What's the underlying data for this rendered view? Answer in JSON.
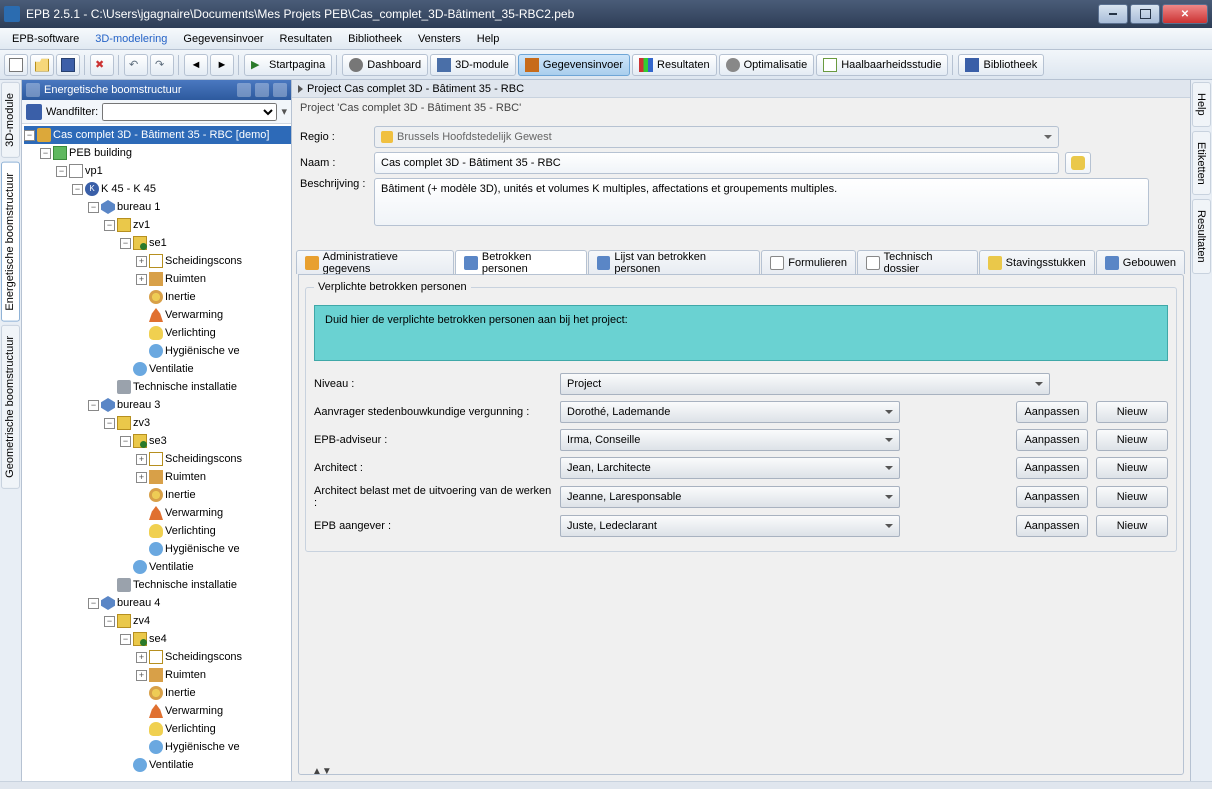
{
  "window": {
    "title": "EPB 2.5.1 - C:\\Users\\jgagnaire\\Documents\\Mes Projets PEB\\Cas_complet_3D-Bâtiment_35-RBC2.peb"
  },
  "menubar": [
    "EPB-software",
    "3D-modelering",
    "Gegevensinvoer",
    "Resultaten",
    "Bibliotheek",
    "Vensters",
    "Help"
  ],
  "toolbar": {
    "start": "Startpagina",
    "dashboard": "Dashboard",
    "module3d": "3D-module",
    "gegevens": "Gegevensinvoer",
    "resultaten": "Resultaten",
    "optimalisatie": "Optimalisatie",
    "haalbaar": "Haalbaarheidsstudie",
    "bibliotheek": "Bibliotheek"
  },
  "leftVTabs": [
    "3D-module",
    "Energetische boomstructuur",
    "Geometrische boomstructuur"
  ],
  "rightVTabs": [
    "Help",
    "Etiketten",
    "Resultaten"
  ],
  "treePanel": {
    "title": "Energetische boomstructuur",
    "filterLabel": "Wandfilter:"
  },
  "tree": [
    {
      "t": "Cas complet 3D - Bâtiment 35 - RBC [demo]",
      "i": "lock",
      "sel": true,
      "c": [
        {
          "t": "PEB building",
          "i": "peb",
          "c": [
            {
              "t": "vp1",
              "i": "vp",
              "c": [
                {
                  "t": "K 45 - K 45",
                  "i": "k",
                  "c": [
                    {
                      "t": "bureau 1",
                      "i": "bureau",
                      "c": [
                        {
                          "t": "zv1",
                          "i": "zv",
                          "c": [
                            {
                              "t": "se1",
                              "i": "se",
                              "c": [
                                {
                                  "t": "Scheidingscons",
                                  "i": "sc",
                                  "exp": "+"
                                },
                                {
                                  "t": "Ruimten",
                                  "i": "ruimten",
                                  "exp": "+"
                                },
                                {
                                  "t": "Inertie",
                                  "i": "inertie"
                                },
                                {
                                  "t": "Verwarming",
                                  "i": "verwarming"
                                },
                                {
                                  "t": "Verlichting",
                                  "i": "verlichting"
                                },
                                {
                                  "t": "Hygiënische ve",
                                  "i": "hyg"
                                }
                              ]
                            },
                            {
                              "t": "Ventilatie",
                              "i": "vent"
                            }
                          ]
                        },
                        {
                          "t": "Technische installatie",
                          "i": "tech"
                        }
                      ]
                    },
                    {
                      "t": "bureau 3",
                      "i": "bureau",
                      "c": [
                        {
                          "t": "zv3",
                          "i": "zv",
                          "c": [
                            {
                              "t": "se3",
                              "i": "se",
                              "c": [
                                {
                                  "t": "Scheidingscons",
                                  "i": "sc",
                                  "exp": "+"
                                },
                                {
                                  "t": "Ruimten",
                                  "i": "ruimten",
                                  "exp": "+"
                                },
                                {
                                  "t": "Inertie",
                                  "i": "inertie"
                                },
                                {
                                  "t": "Verwarming",
                                  "i": "verwarming"
                                },
                                {
                                  "t": "Verlichting",
                                  "i": "verlichting"
                                },
                                {
                                  "t": "Hygiënische ve",
                                  "i": "hyg"
                                }
                              ]
                            },
                            {
                              "t": "Ventilatie",
                              "i": "vent"
                            }
                          ]
                        },
                        {
                          "t": "Technische installatie",
                          "i": "tech"
                        }
                      ]
                    },
                    {
                      "t": "bureau 4",
                      "i": "bureau",
                      "c": [
                        {
                          "t": "zv4",
                          "i": "zv",
                          "c": [
                            {
                              "t": "se4",
                              "i": "se",
                              "c": [
                                {
                                  "t": "Scheidingscons",
                                  "i": "sc",
                                  "exp": "+"
                                },
                                {
                                  "t": "Ruimten",
                                  "i": "ruimten",
                                  "exp": "+"
                                },
                                {
                                  "t": "Inertie",
                                  "i": "inertie"
                                },
                                {
                                  "t": "Verwarming",
                                  "i": "verwarming"
                                },
                                {
                                  "t": "Verlichting",
                                  "i": "verlichting"
                                },
                                {
                                  "t": "Hygiënische ve",
                                  "i": "hyg"
                                }
                              ]
                            },
                            {
                              "t": "Ventilatie",
                              "i": "vent"
                            }
                          ]
                        }
                      ]
                    }
                  ]
                }
              ]
            }
          ]
        }
      ]
    }
  ],
  "content": {
    "breadcrumb": "Project Cas complet 3D - Bâtiment 35 - RBC",
    "subtitle": "Project 'Cas complet 3D - Bâtiment 35 - RBC'",
    "regioLabel": "Regio :",
    "regioValue": "Brussels Hoofdstedelijk Gewest",
    "naamLabel": "Naam :",
    "naamValue": "Cas complet 3D - Bâtiment 35 - RBC",
    "beschLabel": "Beschrijving :",
    "beschValue": "Bâtiment (+ modèle 3D), unités et volumes K multiples, affectations et groupements multiples."
  },
  "tabs": [
    "Administratieve gegevens",
    "Betrokken personen",
    "Lijst van betrokken personen",
    "Formulieren",
    "Technisch dossier",
    "Stavingsstukken",
    "Gebouwen"
  ],
  "personen": {
    "groupTitle": "Verplichte betrokken personen",
    "info": "Duid hier de verplichte betrokken personen aan bij het project:",
    "niveauLabel": "Niveau :",
    "niveauValue": "Project",
    "rows": [
      {
        "label": "Aanvrager stedenbouwkundige vergunning :",
        "value": "Dorothé, Lademande"
      },
      {
        "label": "EPB-adviseur :",
        "value": "Irma, Conseille"
      },
      {
        "label": "Architect :",
        "value": "Jean, Larchitecte"
      },
      {
        "label": "Architect belast met de uitvoering van de werken :",
        "value": "Jeanne, Laresponsable"
      },
      {
        "label": "EPB aangever :",
        "value": "Juste, Ledeclarant"
      }
    ],
    "btnAanpassen": "Aanpassen",
    "btnNieuw": "Nieuw"
  }
}
